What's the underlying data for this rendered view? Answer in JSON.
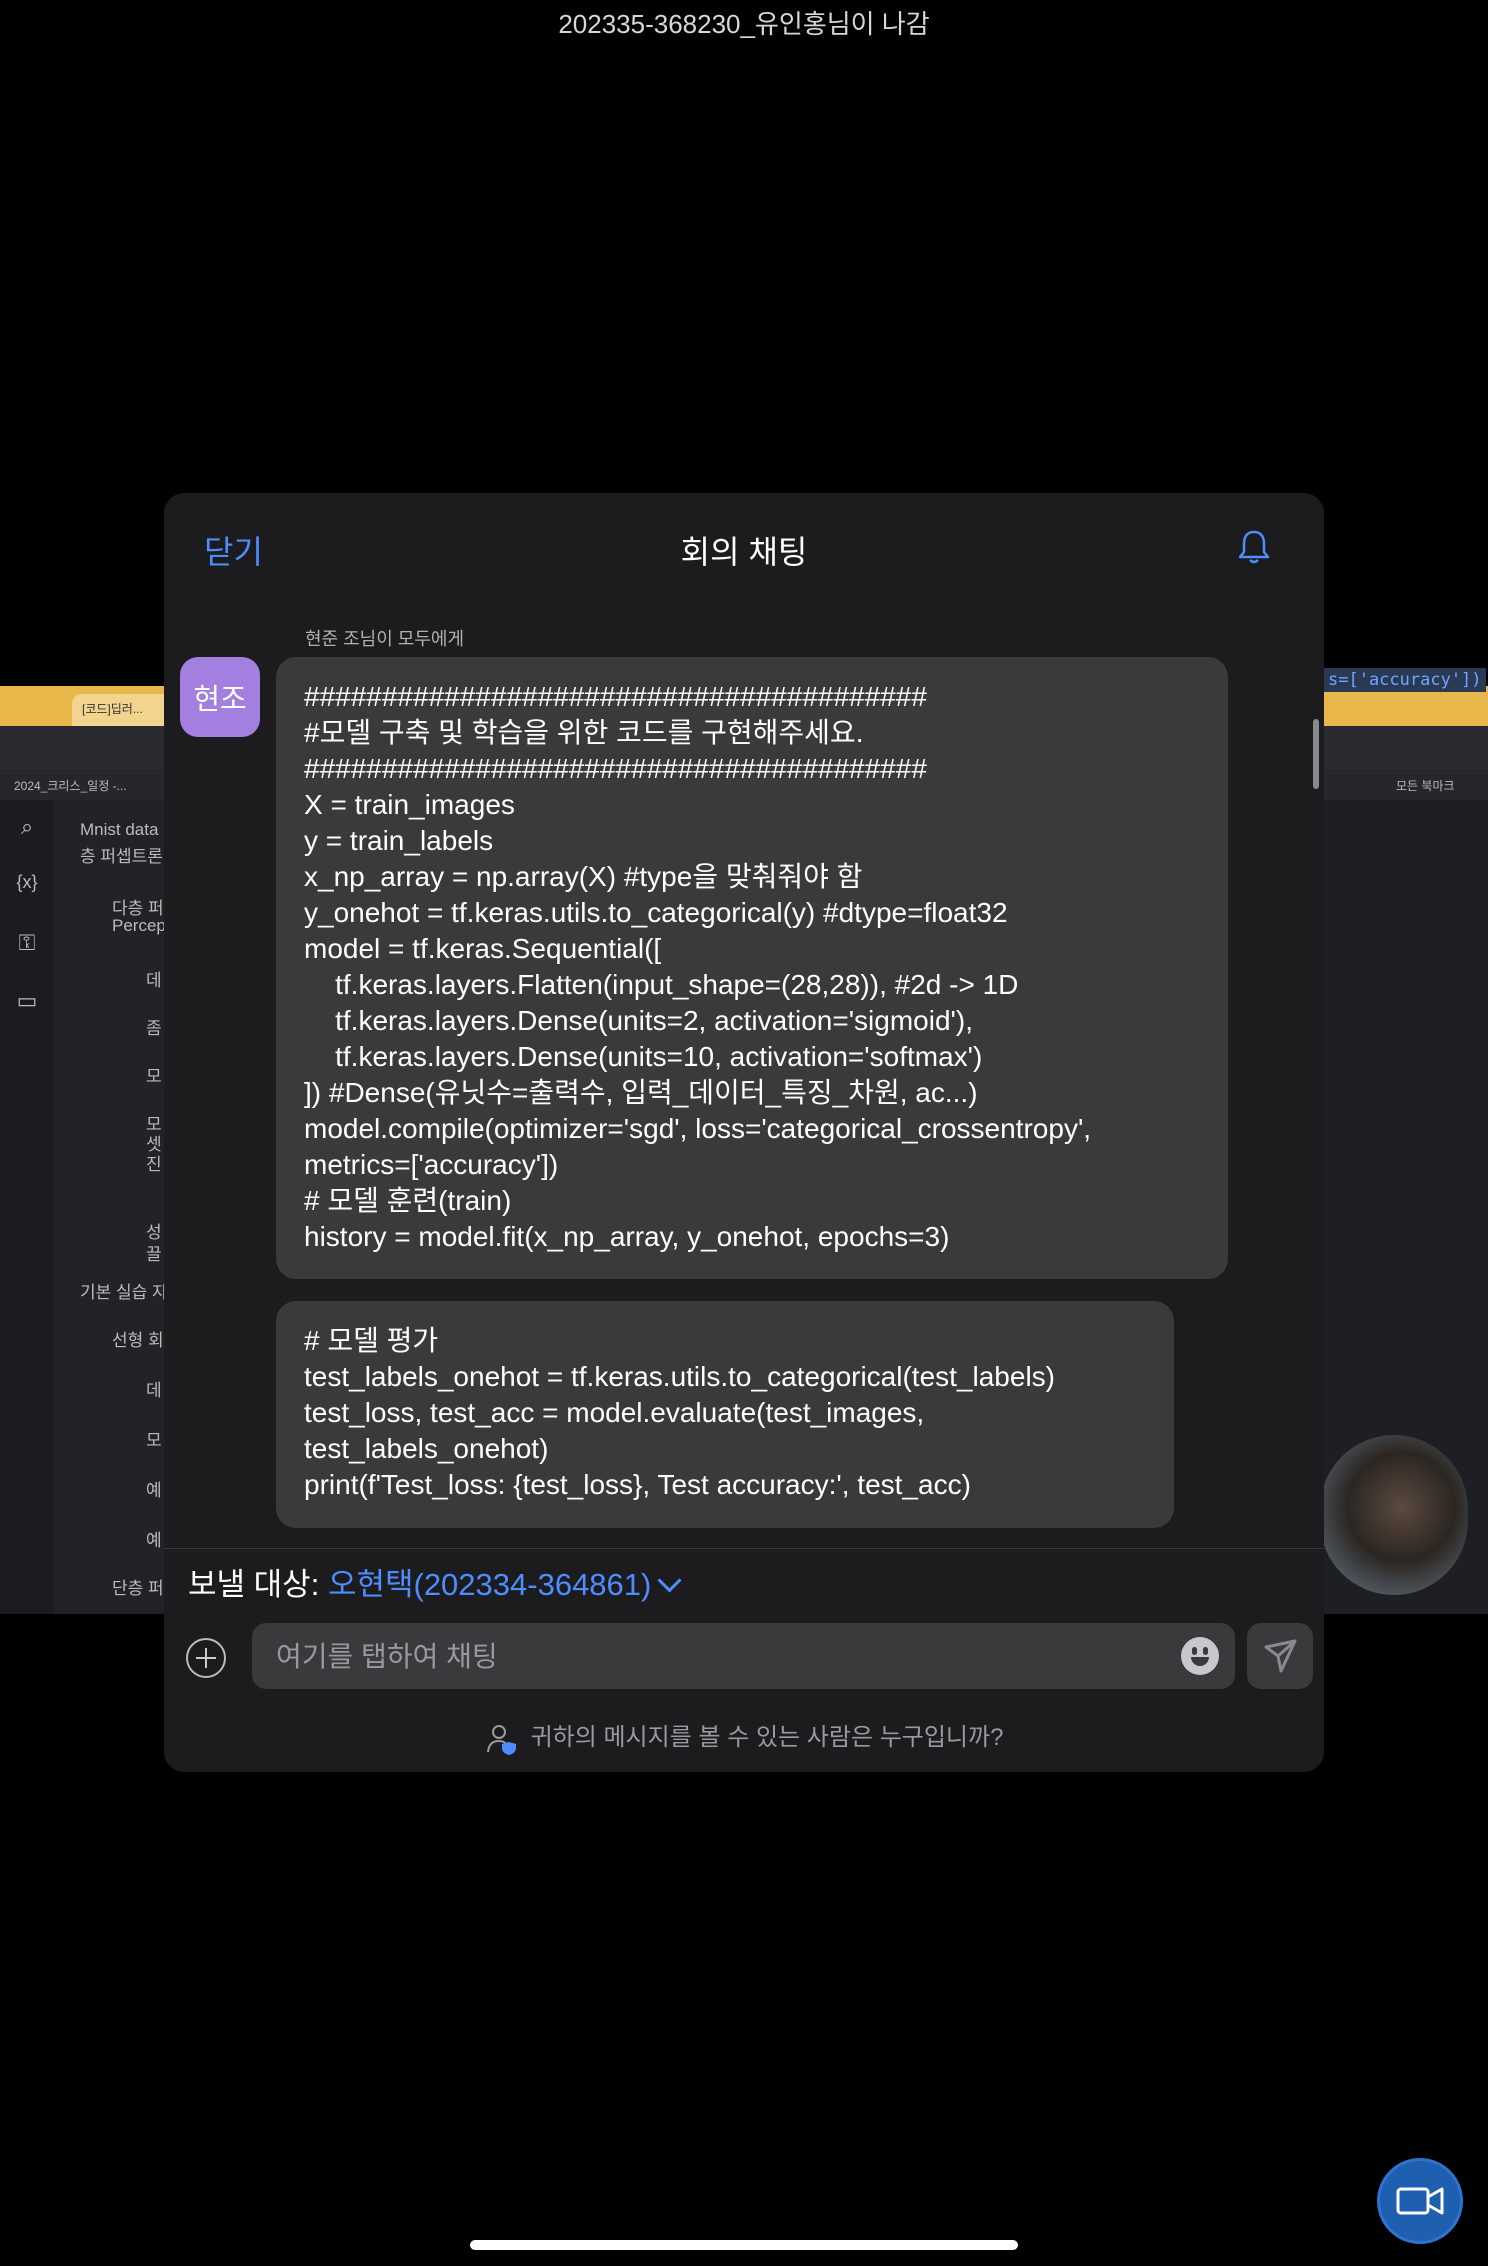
{
  "notification": "202335-368230_유인홍님이 나감",
  "background": {
    "browser_tab": "[코드]딥러...",
    "bookmark_left": "2024_크리스_일정 -...",
    "bookmark_right": "모든 북마크",
    "toc": [
      "Mnist data",
      "층 퍼셉트론",
      "다층 퍼",
      "Percep",
      "데",
      "좀",
      "모",
      "모",
      "셋",
      "진",
      "성",
      "끌",
      "기본 실습 자",
      "선형 회",
      "데",
      "모",
      "예",
      "예",
      "단층 퍼"
    ],
    "code_snippet": "s=['accuracy'])"
  },
  "dialog": {
    "close_label": "닫기",
    "title": "회의 채팅",
    "sender": "현준 조님이 모두에게",
    "avatar_text": "현조",
    "messages": [
      "########################################\n#모델 구축 및 학습을 위한 코드를 구현해주세요.\n########################################\nX = train_images\ny = train_labels\nx_np_array = np.array(X) #type을 맞춰줘야 함\ny_onehot = tf.keras.utils.to_categorical(y) #dtype=float32\nmodel = tf.keras.Sequential([\n    tf.keras.layers.Flatten(input_shape=(28,28)), #2d -> 1D\n    tf.keras.layers.Dense(units=2, activation='sigmoid'),\n    tf.keras.layers.Dense(units=10, activation='softmax')\n]) #Dense(유닛수=출력수, 입력_데이터_특징_차원, ac...)\nmodel.compile(optimizer='sgd', loss='categorical_crossentropy',\nmetrics=['accuracy'])\n# 모델 훈련(train)\nhistory = model.fit(x_np_array, y_onehot, epochs=3)",
      "# 모델 평가\ntest_labels_onehot = tf.keras.utils.to_categorical(test_labels)\ntest_loss, test_acc = model.evaluate(test_images,\ntest_labels_onehot)\nprint(f'Test_loss: {test_loss}, Test accuracy:', test_acc)"
    ],
    "recipient_label": "보낼 대상:",
    "recipient_name": "오현택(202334-364861)",
    "input_placeholder": "여기를 탭하여 채팅",
    "footer_info": "귀하의 메시지를 볼 수 있는 사람은 누구입니까?"
  },
  "colors": {
    "accent": "#4d8dff",
    "dialog_bg": "#1c1c1e",
    "bubble_bg": "#3a3a3c",
    "avatar_bg": "#a37fe0"
  }
}
